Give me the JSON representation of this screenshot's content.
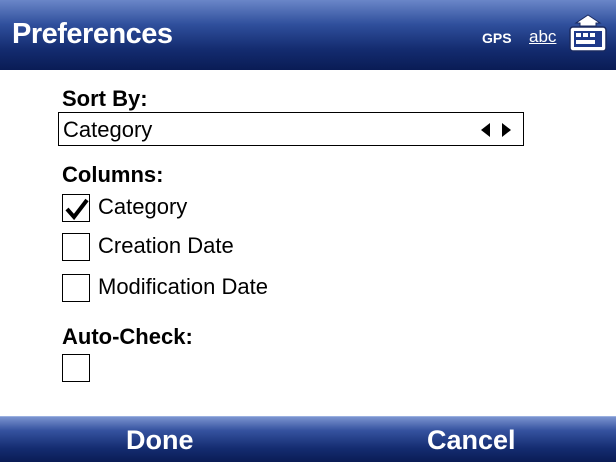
{
  "window": {
    "title": "Preferences",
    "status_gps": "GPS",
    "status_input": "abc",
    "keyboard_icon": "keyboard-icon"
  },
  "sort": {
    "label": "Sort By:",
    "value": "Category",
    "arrows_icon": "left-right-arrows-icon"
  },
  "columns": {
    "label": "Columns:",
    "items": [
      {
        "label": "Category",
        "checked": true
      },
      {
        "label": "Creation Date",
        "checked": false
      },
      {
        "label": "Modification Date",
        "checked": false
      }
    ]
  },
  "auto_check": {
    "label": "Auto-Check:",
    "checked": false
  },
  "softkeys": {
    "left": "Done",
    "right": "Cancel"
  },
  "colors": {
    "bar_top": "#6a86c8",
    "bar_bottom": "#0a1c55"
  }
}
